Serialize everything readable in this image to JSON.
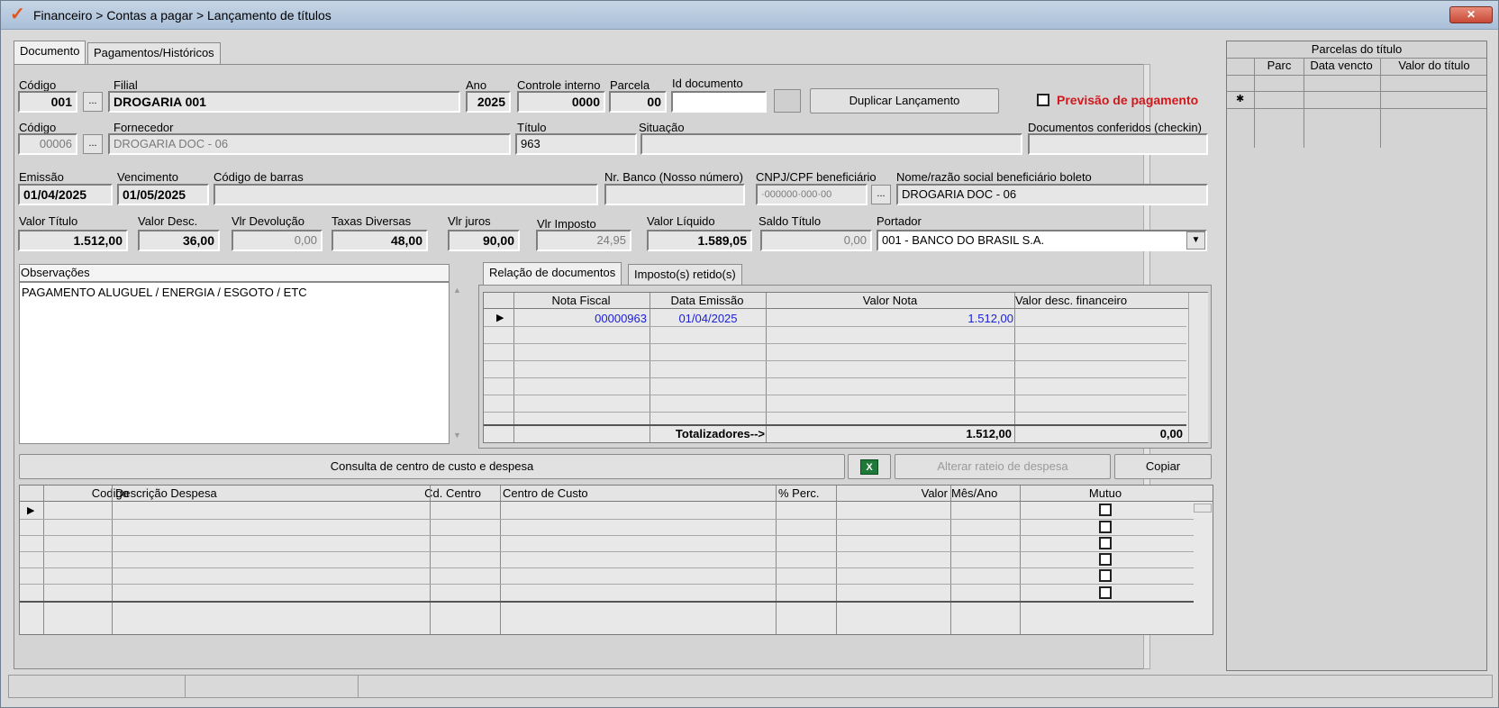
{
  "window": {
    "title": "Financeiro > Contas a pagar > Lançamento de títulos",
    "logo": "✓",
    "close": "✕"
  },
  "tabs": [
    {
      "label": "Documento"
    },
    {
      "label": "Pagamentos/Históricos"
    }
  ],
  "labels": {
    "codigo": "Código",
    "filial": "Filial",
    "ano": "Ano",
    "controle": "Controle interno",
    "parcela": "Parcela",
    "id_documento": "Id documento",
    "codigo2": "Código",
    "fornecedor": "Fornecedor",
    "titulo": "Título",
    "situacao": "Situação",
    "documentos_conferidos": "Documentos conferidos (checkin)",
    "emissao": "Emissão",
    "vencimento": "Vencimento",
    "codigo_barras": "Código de barras",
    "nr_banco": "Nr. Banco (Nosso número)",
    "cnpj": "CNPJ/CPF beneficiário",
    "nome_beneficiario": "Nome/razão social beneficiário boleto",
    "valor_titulo": "Valor Título",
    "valor_desc": "Valor Desc.",
    "vlr_devolucao": "Vlr Devolução",
    "taxas": "Taxas Diversas",
    "vlr_juros": "Vlr juros",
    "vlr_imposto": "Vlr Imposto",
    "valor_liquido": "Valor Líquido",
    "saldo_titulo": "Saldo Título",
    "portador": "Portador",
    "observacoes": "Observações"
  },
  "fields": {
    "codigo": "001",
    "filial": "DROGARIA 001",
    "ano": "2025",
    "controle": "0000",
    "parcela": "00",
    "id_documento": "",
    "fornecedor_codigo": "00006",
    "fornecedor": "DROGARIA DOC - 06",
    "titulo": "963",
    "situacao": "",
    "documentos_conferidos": "",
    "emissao": "01/04/2025",
    "vencimento": "01/05/2025",
    "codigo_barras": "",
    "nr_banco": "",
    "cnpj": "·000000·000·00",
    "nome_beneficiario": "DROGARIA DOC - 06",
    "valor_titulo": "1.512,00",
    "valor_desc": "36,00",
    "vlr_devolucao": "0,00",
    "taxas": "48,00",
    "vlr_juros": "90,00",
    "vlr_imposto": "24,95",
    "valor_liquido": "1.589,05",
    "saldo_titulo": "0,00",
    "portador": "001 - BANCO DO BRASIL S.A.",
    "observacoes": "PAGAMENTO ALUGUEL / ENERGIA / ESGOTO / ETC"
  },
  "buttons": {
    "ellipsis": "...",
    "duplicar": "Duplicar Lançamento",
    "previsao": "Previsão de pagamento",
    "consulta": "Consulta de centro de custo e despesa",
    "alterar": "Alterar rateio de despesa",
    "copiar": "Copiar",
    "excel": "X",
    "dropdown": "▼"
  },
  "doc_tabs": [
    {
      "label": "Relação de documentos"
    },
    {
      "label": "Imposto(s) retido(s)"
    }
  ],
  "docs_grid": {
    "columns": [
      "Nota Fiscal",
      "Data Emissão",
      "Valor Nota",
      "Valor desc. financeiro"
    ],
    "rows": [
      {
        "nota": "00000963",
        "data": "01/04/2025",
        "valor": "1.512,00",
        "desc": ""
      }
    ],
    "totals_label": "Totalizadores-->",
    "total_valor": "1.512,00",
    "total_desc": "0,00"
  },
  "expense_grid": {
    "columns": [
      "Codigo",
      "Descrição Despesa",
      "Cd. Centro",
      "Centro de Custo",
      "% Perc.",
      "Valor",
      "Mês/Ano",
      "Mutuo"
    ]
  },
  "parcelas": {
    "title": "Parcelas do título",
    "columns": [
      "Parc",
      "Data vencto",
      "Valor do título"
    ]
  },
  "status": {
    "seg1": "",
    "seg2": "",
    "seg3": ""
  }
}
